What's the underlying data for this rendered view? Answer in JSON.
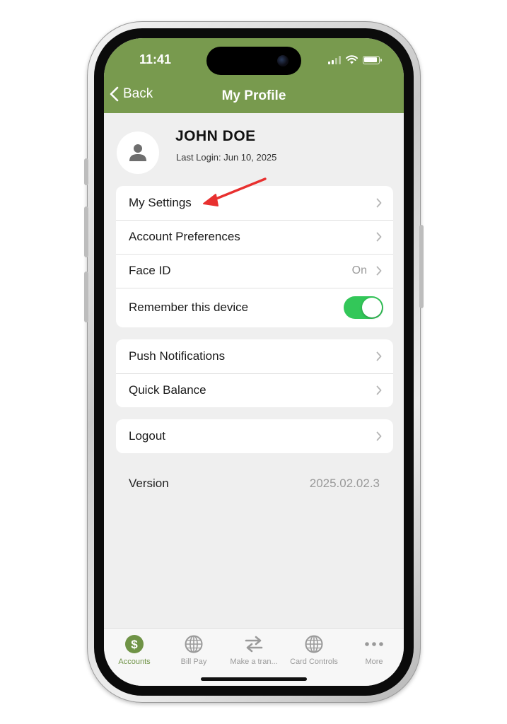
{
  "status_bar": {
    "time": "11:41"
  },
  "header": {
    "back_label": "Back",
    "title": "My Profile"
  },
  "profile": {
    "name": "JOHN DOE",
    "last_login": "Last Login: Jun 10, 2025"
  },
  "groups": [
    {
      "rows": [
        {
          "label": "My Settings"
        },
        {
          "label": "Account Preferences"
        },
        {
          "label": "Face ID",
          "value": "On"
        },
        {
          "label": "Remember this device",
          "toggle": true
        }
      ]
    },
    {
      "rows": [
        {
          "label": "Push Notifications"
        },
        {
          "label": "Quick Balance"
        }
      ]
    },
    {
      "rows": [
        {
          "label": "Logout"
        }
      ]
    }
  ],
  "version": {
    "label": "Version",
    "value": "2025.02.02.3"
  },
  "tabs": [
    {
      "label": "Accounts",
      "icon": "dollar-icon",
      "active": true
    },
    {
      "label": "Bill Pay",
      "icon": "globe-icon"
    },
    {
      "label": "Make a tran...",
      "icon": "transfer-arrows-icon"
    },
    {
      "label": "Card Controls",
      "icon": "globe-icon"
    },
    {
      "label": "More",
      "icon": "more-dots-icon"
    }
  ],
  "colors": {
    "header": "#789a4e",
    "accent": "#6f9346",
    "toggle_on": "#33c759",
    "annotation_arrow": "#e8302f"
  }
}
